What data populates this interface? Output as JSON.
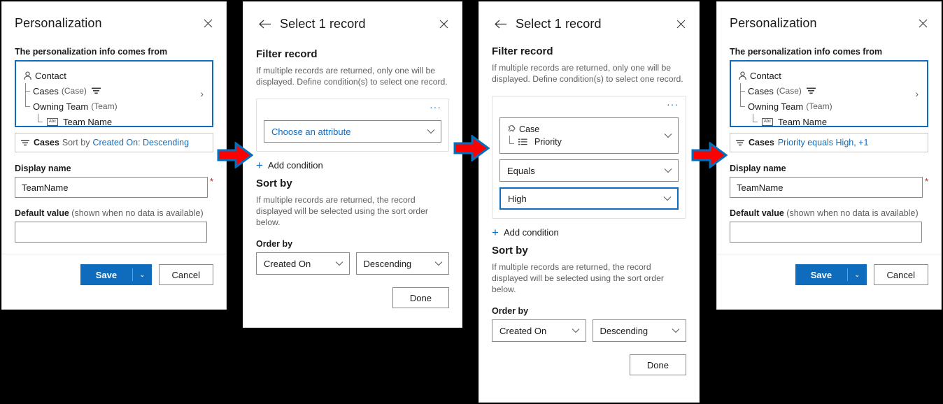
{
  "panels": {
    "personalization_before": {
      "title": "Personalization",
      "close_icon": "close-icon",
      "source_label": "The personalization info comes from",
      "tree": [
        {
          "label": "Contact",
          "suffix": "",
          "icon": "contact-person-icon",
          "level": 0
        },
        {
          "label": "Cases",
          "suffix": "(Case)",
          "icon": "filter-icon",
          "level": 1
        },
        {
          "label": "Owning Team",
          "suffix": "(Team)",
          "icon": "",
          "level": 1
        },
        {
          "label": "Team Name",
          "suffix": "",
          "icon": "abc-text-icon",
          "level": 2
        }
      ],
      "summary": {
        "entity": "Cases",
        "middle": "Sort by",
        "value": "Created On: Descending"
      },
      "display_name_label": "Display name",
      "display_name_value": "TeamName",
      "required_marker": "*",
      "default_value_label": "Default value",
      "default_value_hint": "(shown when no data is available)",
      "default_value": "",
      "save_label": "Save",
      "save_caret": "⌄",
      "cancel_label": "Cancel"
    },
    "select_record_empty": {
      "back_icon": "back-arrow-icon",
      "title": "Select 1 record",
      "close_icon": "close-icon",
      "filter_heading": "Filter record",
      "filter_desc": "If multiple records are returned, only one will be displayed. Define condition(s) to select one record.",
      "overflow_menu": "···",
      "attribute_placeholder": "Choose an attribute",
      "add_condition_label": "Add condition",
      "sort_heading": "Sort by",
      "sort_desc": "If multiple records are returned, the record displayed will be selected using the sort order below.",
      "order_by_label": "Order by",
      "order_field": "Created On",
      "order_direction": "Descending",
      "done_label": "Done"
    },
    "select_record_filled": {
      "back_icon": "back-arrow-icon",
      "title": "Select 1 record",
      "close_icon": "close-icon",
      "filter_heading": "Filter record",
      "filter_desc": "If multiple records are returned, only one will be displayed. Define condition(s) to select one record.",
      "overflow_menu": "···",
      "attribute_entity": "Case",
      "attribute_entity_icon": "entity-puzzle-icon",
      "attribute_field": "Priority",
      "attribute_field_icon": "optionset-list-icon",
      "operator_value": "Equals",
      "condition_value": "High",
      "add_condition_label": "Add condition",
      "sort_heading": "Sort by",
      "sort_desc": "If multiple records are returned, the record displayed will be selected using the sort order below.",
      "order_by_label": "Order by",
      "order_field": "Created On",
      "order_direction": "Descending",
      "done_label": "Done"
    },
    "personalization_after": {
      "title": "Personalization",
      "close_icon": "close-icon",
      "source_label": "The personalization info comes from",
      "tree": [
        {
          "label": "Contact",
          "suffix": "",
          "icon": "contact-person-icon",
          "level": 0
        },
        {
          "label": "Cases",
          "suffix": "(Case)",
          "icon": "filter-icon",
          "level": 1
        },
        {
          "label": "Owning Team",
          "suffix": "(Team)",
          "icon": "",
          "level": 1
        },
        {
          "label": "Team Name",
          "suffix": "",
          "icon": "abc-text-icon",
          "level": 2
        }
      ],
      "summary": {
        "entity": "Cases",
        "middle": "",
        "value": "Priority equals High, +1"
      },
      "display_name_label": "Display name",
      "display_name_value": "TeamName",
      "required_marker": "*",
      "default_value_label": "Default value",
      "default_value_hint": "(shown when no data is available)",
      "default_value": "",
      "save_label": "Save",
      "save_caret": "⌄",
      "cancel_label": "Cancel"
    }
  },
  "arrows": [
    {
      "name": "arrow-step-1"
    },
    {
      "name": "arrow-step-2"
    },
    {
      "name": "arrow-step-3"
    }
  ],
  "colors": {
    "accent_blue": "#0f6cbd",
    "arrow_red": "#fe0000",
    "arrow_outline": "#0070c0",
    "required_red": "#a4262c",
    "background": "#000000"
  }
}
